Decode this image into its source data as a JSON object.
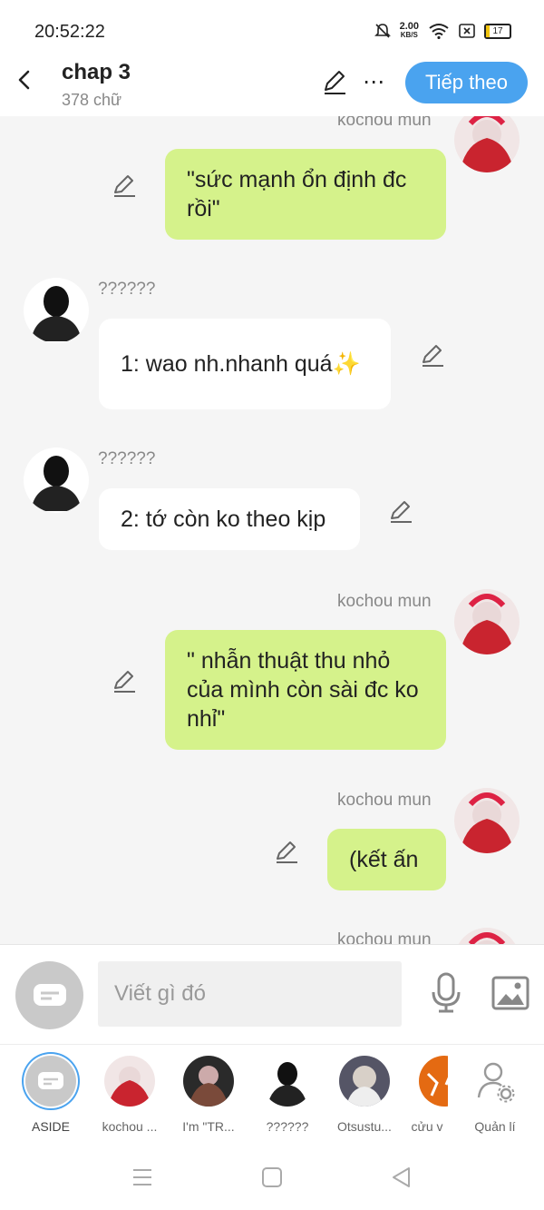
{
  "status": {
    "time": "20:52:22",
    "net_speed": "2.00",
    "net_unit": "KB/S",
    "battery": "17"
  },
  "header": {
    "title": "chap 3",
    "subtitle": "378 chữ",
    "next_label": "Tiếp theo"
  },
  "messages": [
    {
      "speaker": "kochou mun",
      "text": "\"sức mạnh ổn định đc rồi\""
    },
    {
      "speaker": "??????",
      "text": "1: wao nh.nhanh quá✨"
    },
    {
      "speaker": "??????",
      "text": "2: tớ còn ko theo kịp"
    },
    {
      "speaker": "kochou mun",
      "text": "\" nhẫn thuật thu nhỏ của mình còn sài đc ko nhỉ\""
    },
    {
      "speaker": "kochou mun",
      "text": "(kết ấn"
    },
    {
      "speaker": "kochou mun",
      "text": ""
    }
  ],
  "input": {
    "placeholder": "Viết gì đó"
  },
  "characters": [
    {
      "label": "ASIDE",
      "icon": "chat-bubble-icon"
    },
    {
      "label": "kochou ..."
    },
    {
      "label": "I'm \"TR..."
    },
    {
      "label": "??????"
    },
    {
      "label": "Otsustu..."
    },
    {
      "label": "cửu v"
    },
    {
      "label": "Quản lí",
      "icon": "user-gear-icon"
    }
  ],
  "colors": {
    "accent": "#4aa3ef",
    "my_bubble": "#d5f28b",
    "other_bubble": "#ffffff"
  }
}
